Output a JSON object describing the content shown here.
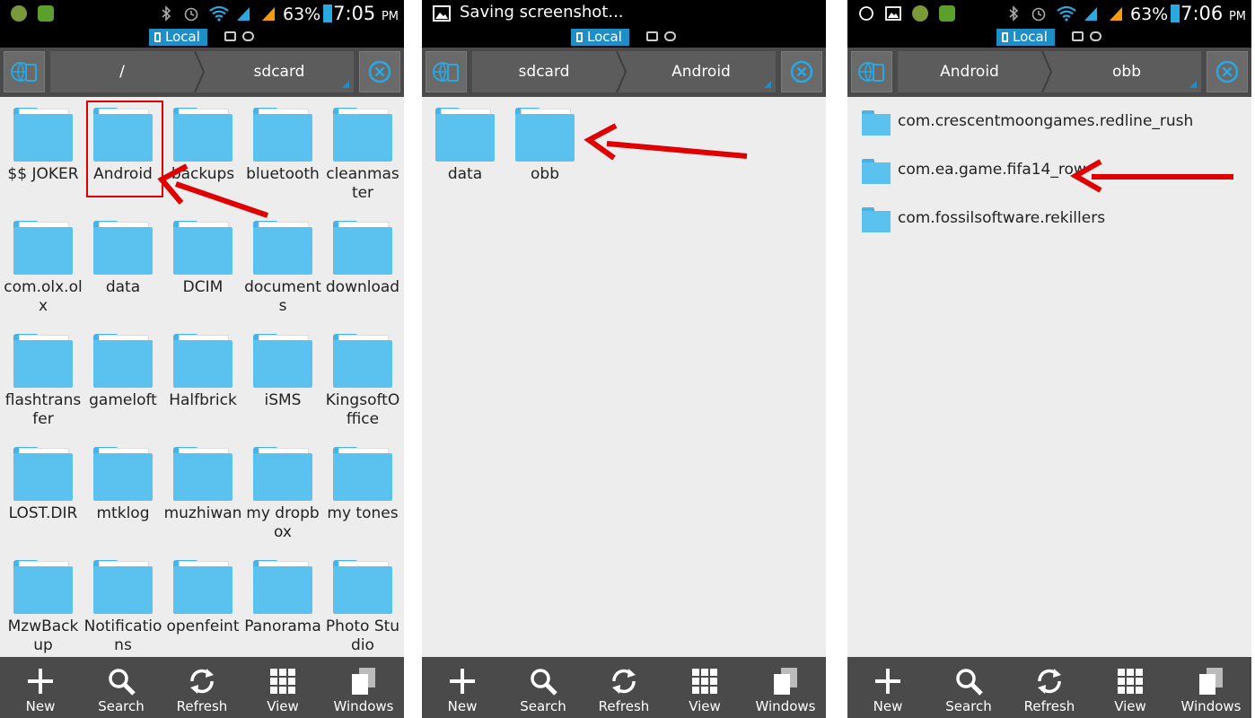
{
  "panels": [
    {
      "status": {
        "time": "7:05",
        "ampm": "PM",
        "battery": "63%",
        "title": ""
      },
      "tab_local": "Local",
      "breadcrumbs": [
        "/",
        "sdcard"
      ],
      "folders": [
        "$$ JOKER",
        "Android",
        "backups",
        "bluetooth",
        "cleanmaster",
        "com.olx.olx",
        "data",
        "DCIM",
        "documents",
        "download",
        "flashtransfer",
        "gameloft",
        "Halfbrick",
        "iSMS",
        "KingsoftOffice",
        "LOST.DIR",
        "mtklog",
        "muzhiwan",
        "my dropbox",
        "my tones",
        "MzwBackup",
        "Notifications",
        "openfeint",
        "Panorama",
        "Photo Studio"
      ],
      "highlighted_folder": "Android"
    },
    {
      "status": {
        "time": "",
        "ampm": "",
        "battery": "",
        "title": "Saving screenshot..."
      },
      "tab_local": "Local",
      "breadcrumbs": [
        "sdcard",
        "Android"
      ],
      "folders": [
        "data",
        "obb"
      ],
      "highlighted_folder": "obb"
    },
    {
      "status": {
        "time": "7:06",
        "ampm": "PM",
        "battery": "63%",
        "title": ""
      },
      "tab_local": "Local",
      "breadcrumbs": [
        "Android",
        "obb"
      ],
      "list_items": [
        "com.crescentmoongames.redline_rush",
        "com.ea.game.fifa14_row",
        "com.fossilsoftware.rekillers"
      ],
      "highlighted_item": "com.ea.game.fifa14_row"
    }
  ],
  "bottom_bar": [
    "New",
    "Search",
    "Refresh",
    "View",
    "Windows"
  ],
  "colors": {
    "accent": "#1e8fc6",
    "folder": "#5bc2ef",
    "arrow": "#e00000",
    "toolbar": "#4a4a4a"
  },
  "icons": {
    "network": "globe-device-icon",
    "close": "close-circle-icon"
  }
}
